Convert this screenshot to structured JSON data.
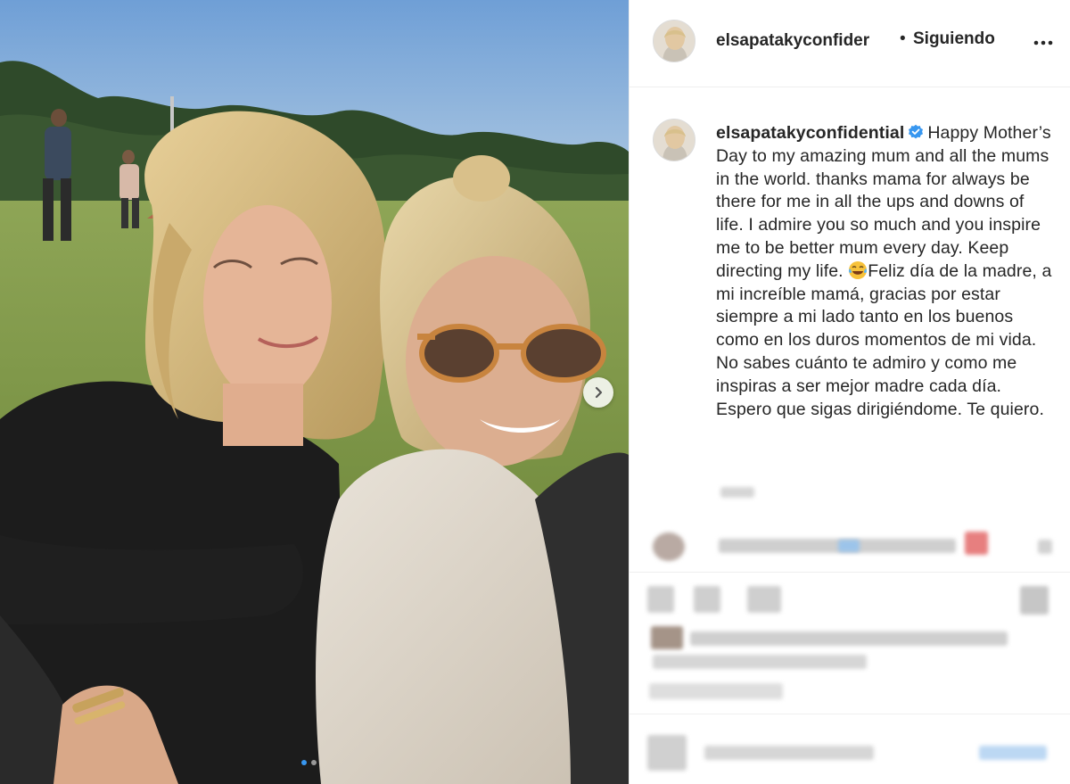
{
  "post": {
    "carousel": {
      "slides": 2,
      "active": 0
    },
    "icons": {
      "next": "chevron-right-icon",
      "more": "more-horizontal-icon",
      "verified": "verified-badge-icon",
      "emoji": "tears-of-joy-emoji"
    }
  },
  "header": {
    "username": "elsapatakyconfider",
    "separator": "•",
    "follow_label": "Siguiendo"
  },
  "caption": {
    "username": "elsapatakyconfidential",
    "text_before_emoji": "Happy Mother’s Day to my amazing mum and all the mums in the world. thanks mama for always be there for me in all the ups and downs of life. I admire you so much and you inspire me to be better mum every day. Keep directing my life.",
    "text_after_emoji": "Feliz día de la madre, a mi increíble mamá, gracias por estar siempre a mi lado tanto en los buenos como en los duros momentos de mi vida. No sabes cuánto te admiro y como me inspiras a ser mejor madre cada día. Espero que sigas dirigiéndome. Te quiero."
  },
  "colors": {
    "accent": "#3897f0",
    "verified": "#3897f0",
    "text": "#262626",
    "divider": "#efefef"
  }
}
